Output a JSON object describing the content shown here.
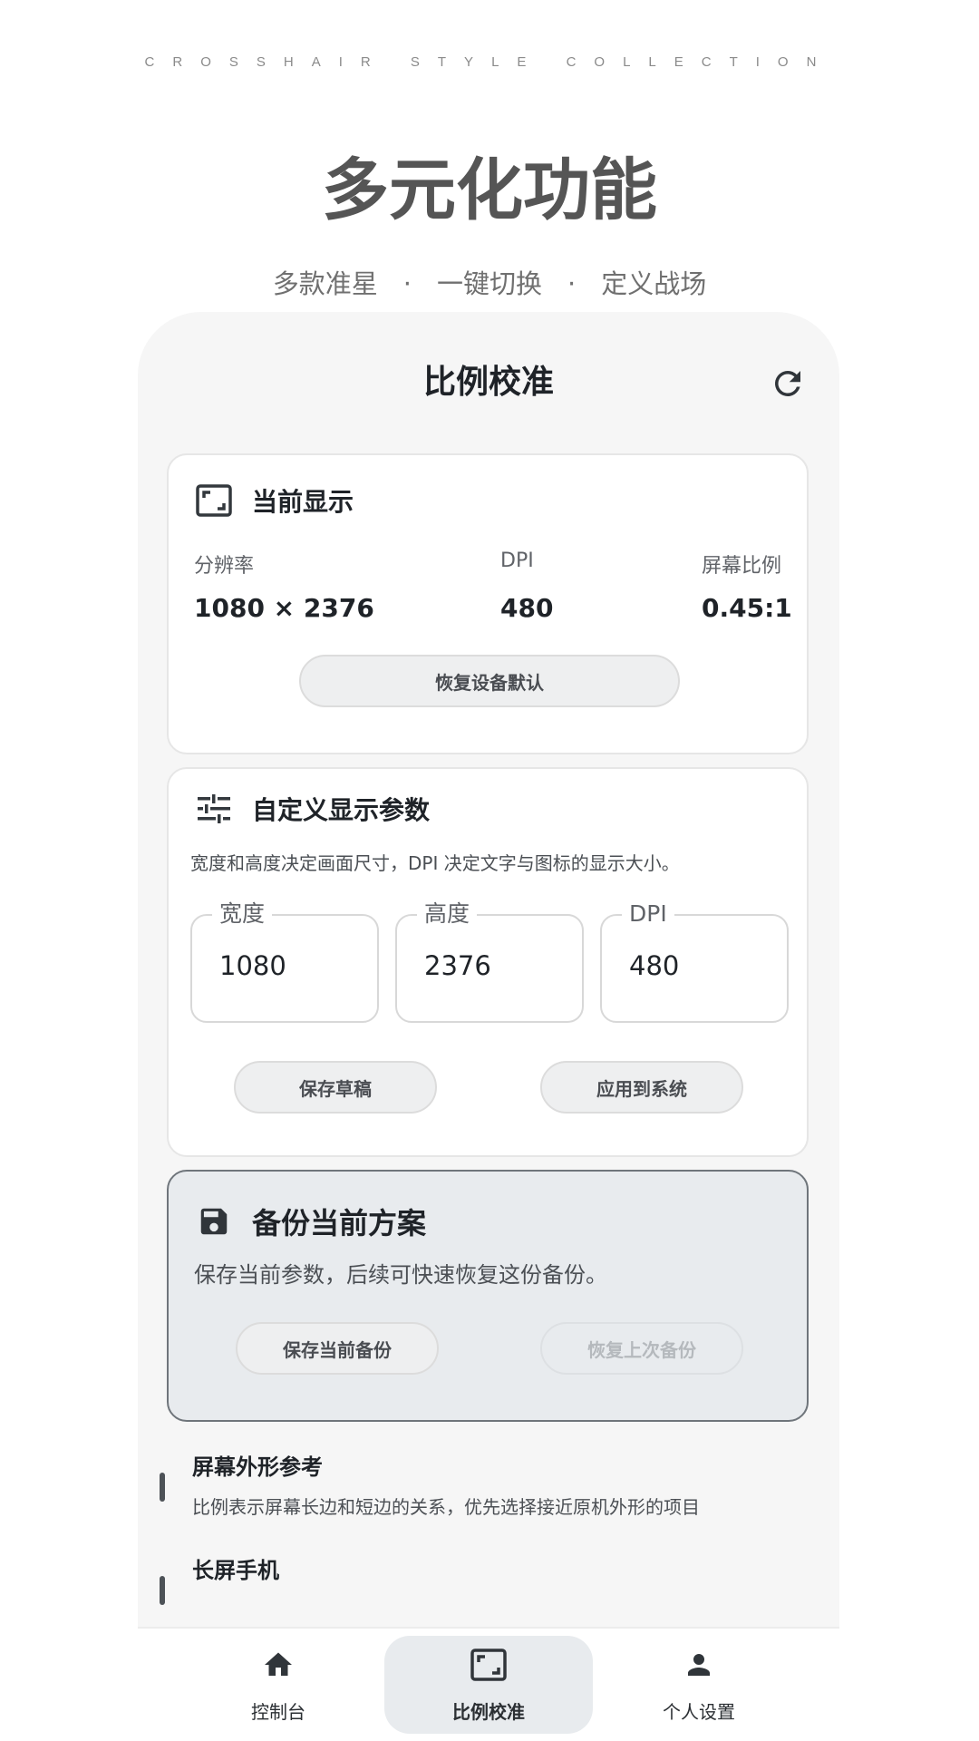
{
  "promo": {
    "tagline": "CROSSHAIR STYLE COLLECTION",
    "title": "多元化功能",
    "subtitle_parts": [
      "多款准星",
      "一键切换",
      "定义战场"
    ],
    "separator": "·"
  },
  "header": {
    "title": "比例校准",
    "refresh_icon": "refresh-icon"
  },
  "current_display": {
    "title": "当前显示",
    "icon": "aspect-ratio-icon",
    "stats": [
      {
        "label": "分辨率",
        "value": "1080 × 2376"
      },
      {
        "label": "DPI",
        "value": "480"
      },
      {
        "label": "屏幕比例",
        "value": "0.45:1"
      }
    ],
    "reset_button": "恢复设备默认"
  },
  "custom_params": {
    "title": "自定义显示参数",
    "icon": "tune-icon",
    "description": "宽度和高度决定画面尺寸，DPI 决定文字与图标的显示大小。",
    "fields": [
      {
        "label": "宽度",
        "value": "1080"
      },
      {
        "label": "高度",
        "value": "2376"
      },
      {
        "label": "DPI",
        "value": "480"
      }
    ],
    "save_draft_button": "保存草稿",
    "apply_button": "应用到系统"
  },
  "backup": {
    "title": "备份当前方案",
    "icon": "save-icon",
    "description": "保存当前参数，后续可快速恢复这份备份。",
    "save_button": "保存当前备份",
    "restore_button": "恢复上次备份",
    "restore_enabled": false
  },
  "reference": {
    "items": [
      {
        "title": "屏幕外形参考",
        "description": "比例表示屏幕长边和短边的关系，优先选择接近原机外形的项目"
      },
      {
        "title": "长屏手机",
        "description": ""
      }
    ]
  },
  "bottom_nav": {
    "items": [
      {
        "label": "控制台",
        "icon": "home-icon",
        "active": false
      },
      {
        "label": "比例校准",
        "icon": "aspect-ratio-icon",
        "active": true
      },
      {
        "label": "个人设置",
        "icon": "person-icon",
        "active": false
      }
    ]
  },
  "colors": {
    "accent_bg": "#e8ebee",
    "text": "#1f2328",
    "phone_bg": "#f6f6f6"
  }
}
